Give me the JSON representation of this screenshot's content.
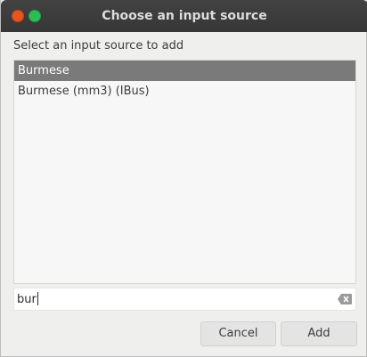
{
  "window": {
    "title": "Choose an input source"
  },
  "prompt": "Select an input source to add",
  "sources": [
    {
      "label": "Burmese",
      "selected": true
    },
    {
      "label": "Burmese (mm3) (IBus)",
      "selected": false
    }
  ],
  "search": {
    "value": "bur"
  },
  "buttons": {
    "cancel": "Cancel",
    "add": "Add"
  },
  "icons": {
    "close": "close-icon",
    "maximize": "maximize-icon",
    "clear": "backspace-clear-icon"
  },
  "colors": {
    "titlebar": "#3c3c3c",
    "close": "#e95420",
    "maximize": "#2dbd55",
    "selection": "#7a7a7a"
  }
}
